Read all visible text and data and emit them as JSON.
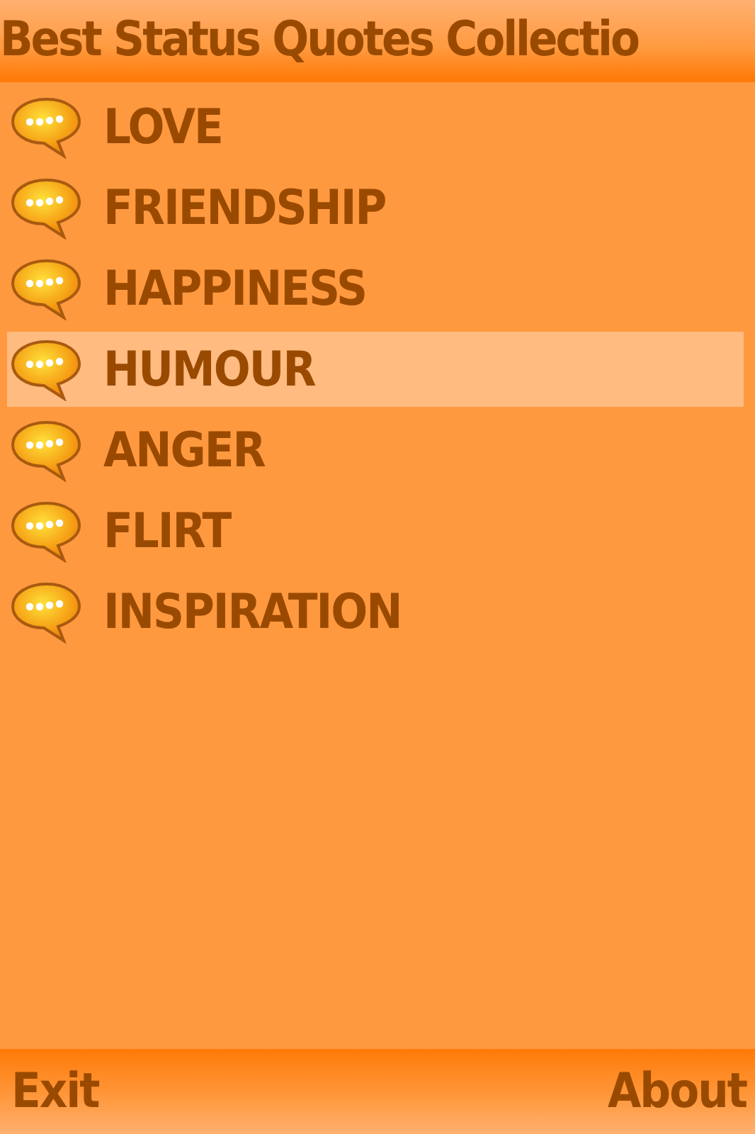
{
  "window": {
    "title": "Best Status Quotes Collectio"
  },
  "items": [
    {
      "label": "LOVE",
      "selected": false
    },
    {
      "label": "FRIENDSHIP",
      "selected": false
    },
    {
      "label": "HAPPINESS",
      "selected": false
    },
    {
      "label": "HUMOUR",
      "selected": true
    },
    {
      "label": "ANGER",
      "selected": false
    },
    {
      "label": "FLIRT",
      "selected": false
    },
    {
      "label": "INSPIRATION",
      "selected": false
    }
  ],
  "softkeys": {
    "left": "Exit",
    "right": "About"
  }
}
